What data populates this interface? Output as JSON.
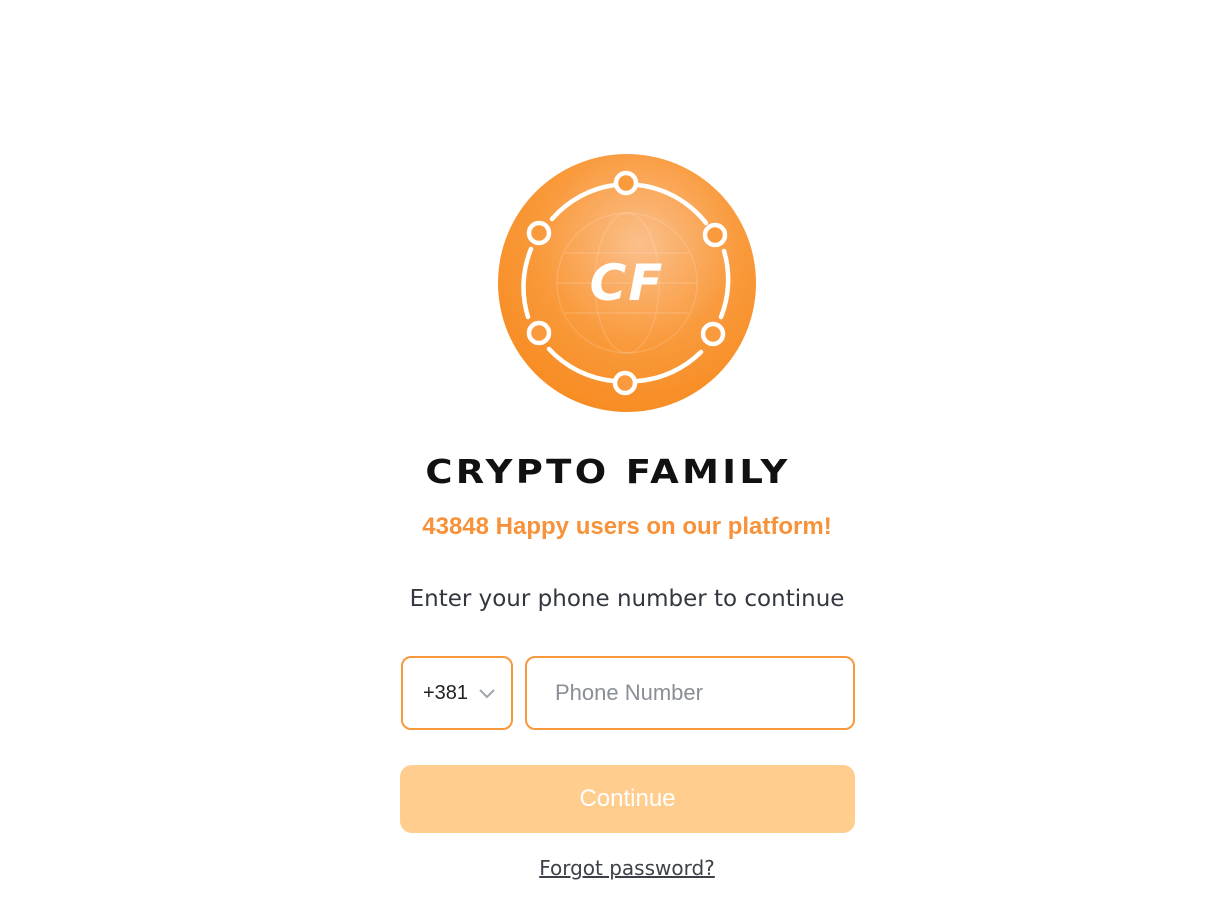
{
  "brand": {
    "logo_text": "CF",
    "name": "CRYPTO FAMILY"
  },
  "tagline": "43848 Happy users on our platform!",
  "prompt": "Enter your phone number to continue",
  "form": {
    "country_code": "+381",
    "phone_placeholder": "Phone Number",
    "phone_value": "",
    "continue_label": "Continue",
    "forgot_label": "Forgot password?"
  },
  "icons": {
    "logo": "crypto-family-logo-icon",
    "chevron": "chevron-down-icon"
  },
  "colors": {
    "accent": "#f7923a",
    "input_border": "#f6993d",
    "button_disabled": "#ffcd8e"
  }
}
